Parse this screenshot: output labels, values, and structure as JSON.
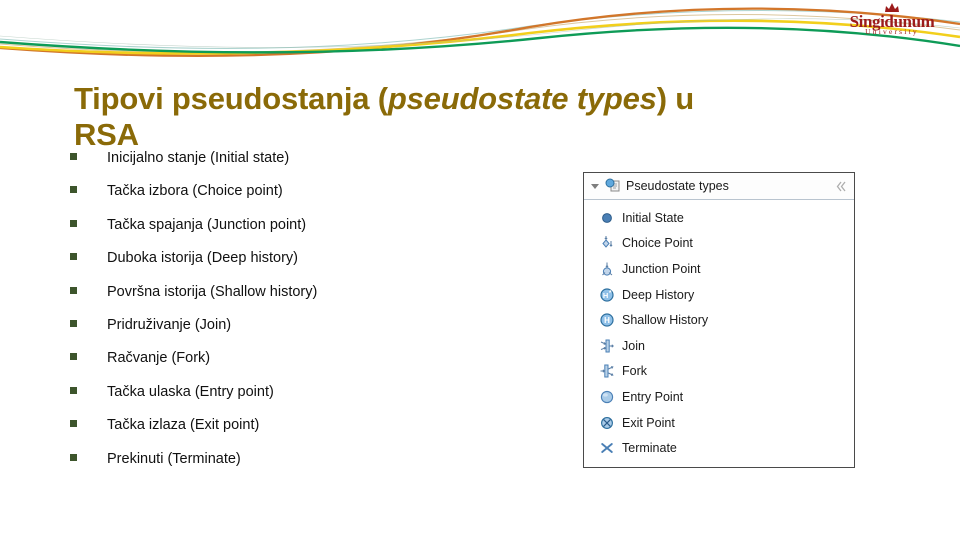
{
  "branding": {
    "logo_name": "Singidunum",
    "logo_subtitle": "University",
    "logo_color": "#9c1b1b",
    "crest_icon": "crown-crest-icon"
  },
  "decoration": {
    "curve_colors": {
      "orange": "#d2762a",
      "yellow": "#f2cf1c",
      "green": "#0e9b57",
      "teal": "#5aa8a0",
      "tan": "#c9a96a"
    }
  },
  "title": {
    "line1_part1": "Tipovi pseudostanja (",
    "line1_italic": "pseudostate types",
    "line1_part2": ") u",
    "line2": "RSA",
    "color": "#8a6a08"
  },
  "bullets": {
    "marker_color": "#3d552c",
    "items": [
      {
        "label": "Inicijalno stanje (Initial state)"
      },
      {
        "label": "Tačka izbora (Choice point)"
      },
      {
        "label": "Tačka spajanja (Junction point)"
      },
      {
        "label": "Duboka istorija (Deep history)"
      },
      {
        "label": "Površna istorija (Shallow history)"
      },
      {
        "label": "Pridruživanje (Join)"
      },
      {
        "label": "Račvanje (Fork)"
      },
      {
        "label": "Tačka ulaska (Entry point)"
      },
      {
        "label": "Tačka izlaza (Exit point)"
      },
      {
        "label": "Prekinuti (Terminate)"
      }
    ]
  },
  "panel": {
    "header": {
      "title": "Pseudostate types",
      "collapse_icon": "chevron-down-icon",
      "header_icon": "palette-document-icon",
      "pin_icon": "collapse-pin-icon"
    },
    "items": [
      {
        "label": "Initial State",
        "icon": "initial-state-icon"
      },
      {
        "label": "Choice Point",
        "icon": "choice-point-icon"
      },
      {
        "label": "Junction Point",
        "icon": "junction-point-icon"
      },
      {
        "label": "Deep History",
        "icon": "deep-history-icon"
      },
      {
        "label": "Shallow History",
        "icon": "shallow-history-icon"
      },
      {
        "label": "Join",
        "icon": "join-icon"
      },
      {
        "label": "Fork",
        "icon": "fork-icon"
      },
      {
        "label": "Entry Point",
        "icon": "entry-point-icon"
      },
      {
        "label": "Exit Point",
        "icon": "exit-point-icon"
      },
      {
        "label": "Terminate",
        "icon": "terminate-icon"
      }
    ]
  }
}
